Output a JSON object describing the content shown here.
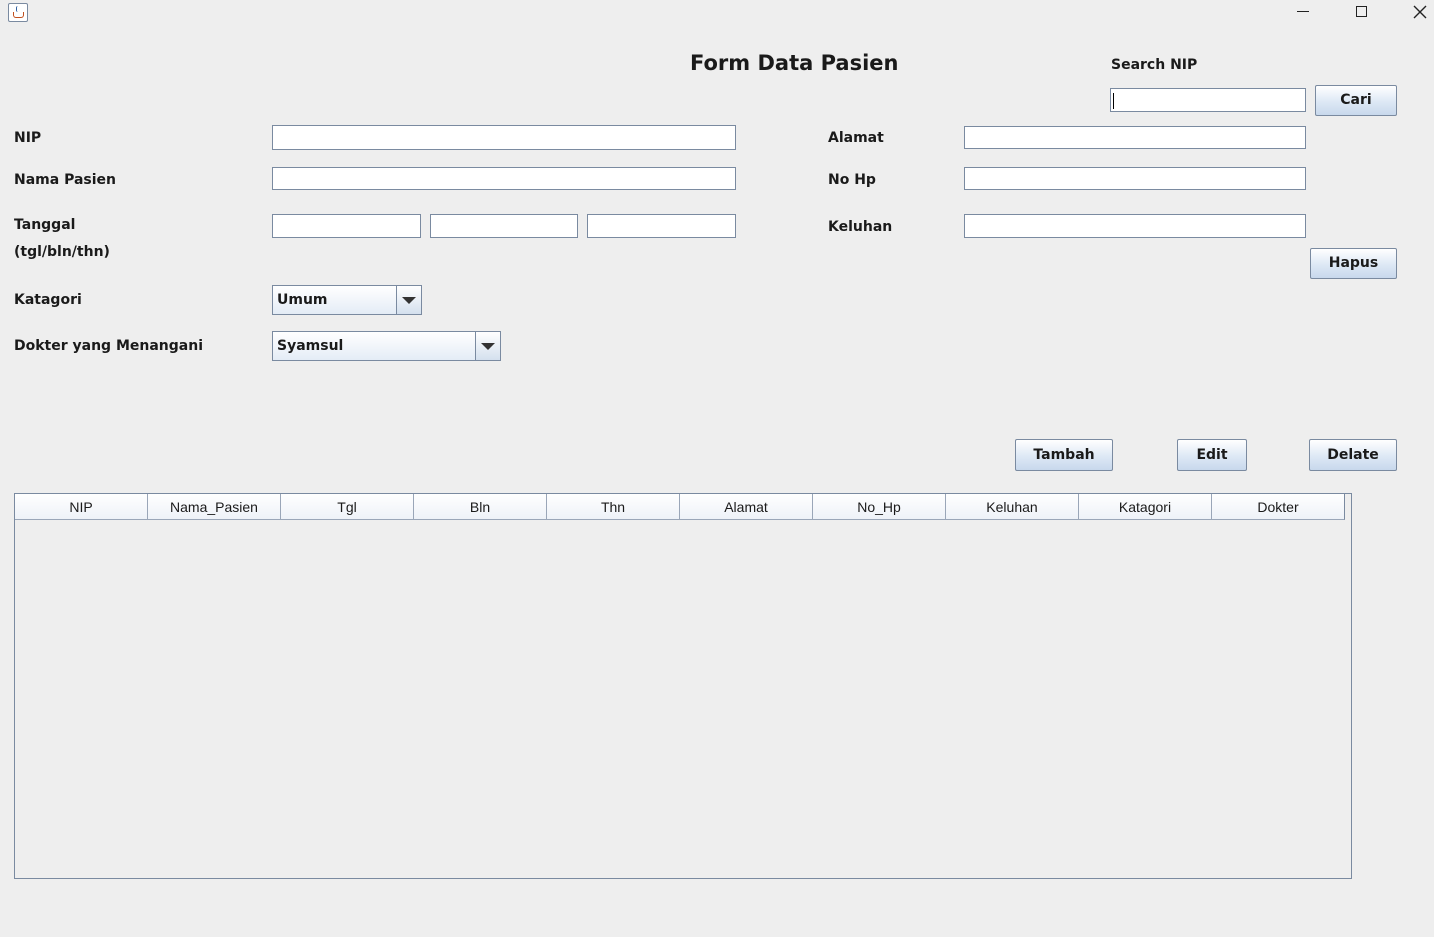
{
  "window": {
    "icon": "java-cup-icon"
  },
  "form": {
    "title": "Form Data Pasien",
    "search_label": "Search NIP",
    "search_value": "",
    "search_button": "Cari",
    "labels": {
      "nip": "NIP",
      "nama": "Nama Pasien",
      "tanggal": "Tanggal",
      "tanggal_hint": "(tgl/bln/thn)",
      "katagori": "Katagori",
      "dokter": "Dokter yang Menangani",
      "alamat": "Alamat",
      "nohp": "No Hp",
      "keluhan": "Keluhan"
    },
    "values": {
      "nip": "",
      "nama": "",
      "tgl": "",
      "bln": "",
      "thn": "",
      "alamat": "",
      "nohp": "",
      "keluhan": ""
    },
    "katagori_selected": "Umum",
    "dokter_selected": "Syamsul",
    "buttons": {
      "hapus": "Hapus",
      "tambah": "Tambah",
      "edit": "Edit",
      "delete": "Delate"
    }
  },
  "table": {
    "columns": [
      "NIP",
      "Nama_Pasien",
      "Tgl",
      "Bln",
      "Thn",
      "Alamat",
      "No_Hp",
      "Keluhan",
      "Katagori",
      "Dokter"
    ],
    "rows": []
  }
}
